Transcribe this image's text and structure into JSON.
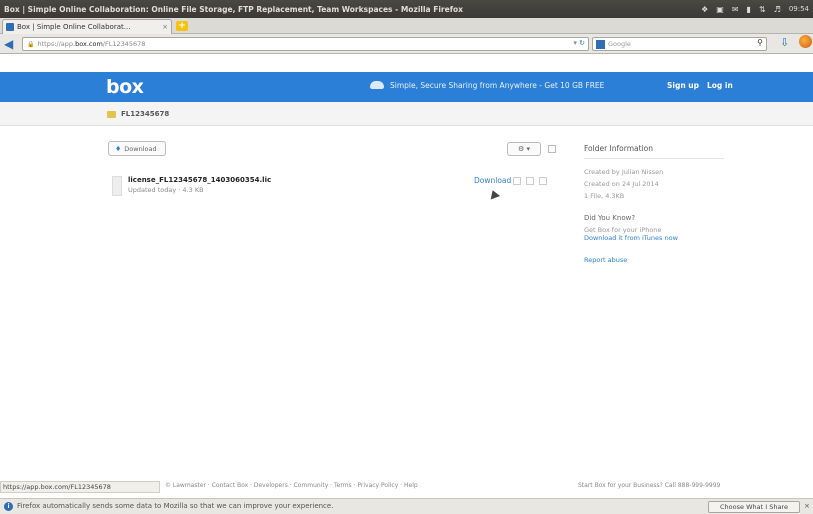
{
  "window": {
    "title": "Box | Simple Online Collaboration: Online File Storage, FTP Replacement, Team Workspaces - Mozilla Firefox",
    "time": "09:54"
  },
  "browser": {
    "tab_label": "Box | Simple Online Collaborat...",
    "url_prefix": "https://app.",
    "url_domain": "box.com",
    "url_rest": "/FL12345678",
    "search_placeholder": "Google"
  },
  "box": {
    "logo": "box",
    "tagline": "Simple, Secure Sharing from Anywhere - Get 10 GB FREE",
    "signup": "Sign up",
    "login": "Log in",
    "breadcrumb": "FL12345678",
    "upload_label": "Download",
    "file": {
      "name": "license_FL12345678_1403060354.lic",
      "meta": "Updated today  ·  4.3 KB",
      "share_label": "Download"
    },
    "sidebar": {
      "title": "Folder Information",
      "created_by": "Created by Julian Nissen",
      "created_on": "Created on 24 Jul 2014",
      "file_count": "1 File, 4.3KB",
      "did_you_know": "Did You Know?",
      "app_promo": "Get Box for your iPhone",
      "app_link": "Download it from iTunes now",
      "report_abuse": "Report abuse"
    }
  },
  "footer": {
    "status_url": "https://app.box.com/FL12345678",
    "links": "© Lawmaster · Contact Box · Developers · Community · Terms · Privacy Policy · Help",
    "sales": "Start Box for your Business? Call 888-999-9999"
  },
  "notification": {
    "message": "Firefox automatically sends some data to Mozilla so that we can improve your experience.",
    "button": "Choose What I Share"
  }
}
